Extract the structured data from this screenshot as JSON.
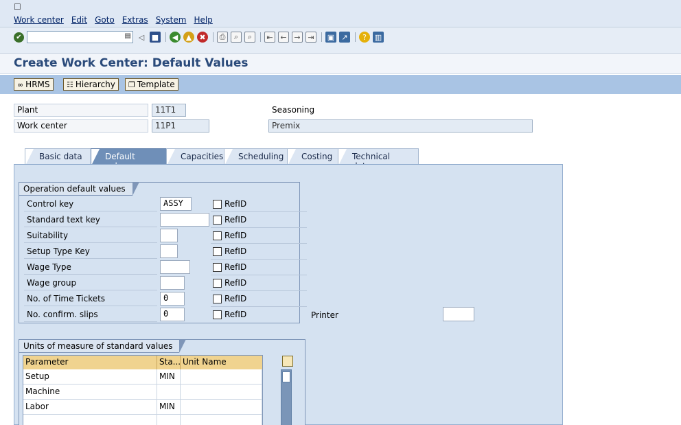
{
  "menu": {
    "icon": "menu-icon",
    "items": [
      "Work center",
      "Edit",
      "Goto",
      "Extras",
      "System",
      "Help"
    ]
  },
  "toolbar": {
    "command_value": "",
    "icons": [
      "enter-icon",
      "back-icon",
      "save-icon",
      "green-back-icon",
      "exit-icon",
      "cancel-icon",
      "print-icon",
      "find-icon",
      "find-next-icon",
      "first-page-icon",
      "prev-page-icon",
      "next-page-icon",
      "last-page-icon",
      "new-session-icon",
      "shortcut-icon",
      "help-icon",
      "layout-icon"
    ]
  },
  "title": "Create Work Center: Default Values",
  "app_buttons": {
    "hrms": "HRMS",
    "hierarchy": "Hierarchy",
    "template": "Template"
  },
  "header": {
    "plant_label": "Plant",
    "plant_value": "11T1",
    "plant_desc": "Seasoning",
    "work_center_label": "Work center",
    "work_center_value": "11P1",
    "work_center_desc": "Premix"
  },
  "tabs": [
    {
      "label": "Basic data",
      "active": false
    },
    {
      "label": "Default values",
      "active": true
    },
    {
      "label": "Capacities",
      "active": false
    },
    {
      "label": "Scheduling",
      "active": false
    },
    {
      "label": "Costing",
      "active": false
    },
    {
      "label": "Technical data",
      "active": false
    }
  ],
  "operation_defaults": {
    "title": "Operation default values",
    "refid_label": "RefID",
    "rows": [
      {
        "label": "Control key",
        "value": "ASSY"
      },
      {
        "label": "Standard text key",
        "value": ""
      },
      {
        "label": "Suitability",
        "value": ""
      },
      {
        "label": "Setup Type Key",
        "value": ""
      },
      {
        "label": "Wage Type",
        "value": ""
      },
      {
        "label": "Wage group",
        "value": ""
      },
      {
        "label": "No. of Time Tickets",
        "value": "0"
      },
      {
        "label": "No. confirm. slips",
        "value": "0"
      }
    ],
    "printer_label": "Printer",
    "printer_value": ""
  },
  "units": {
    "title": "Units of measure of standard values",
    "columns": [
      "Parameter",
      "Sta...",
      "Unit Name"
    ],
    "rows": [
      {
        "parameter": "Setup",
        "std": "MIN",
        "unit_name": ""
      },
      {
        "parameter": "Machine",
        "std": "",
        "unit_name": ""
      },
      {
        "parameter": "Labor",
        "std": "MIN",
        "unit_name": ""
      },
      {
        "parameter": "",
        "std": "",
        "unit_name": ""
      }
    ]
  }
}
